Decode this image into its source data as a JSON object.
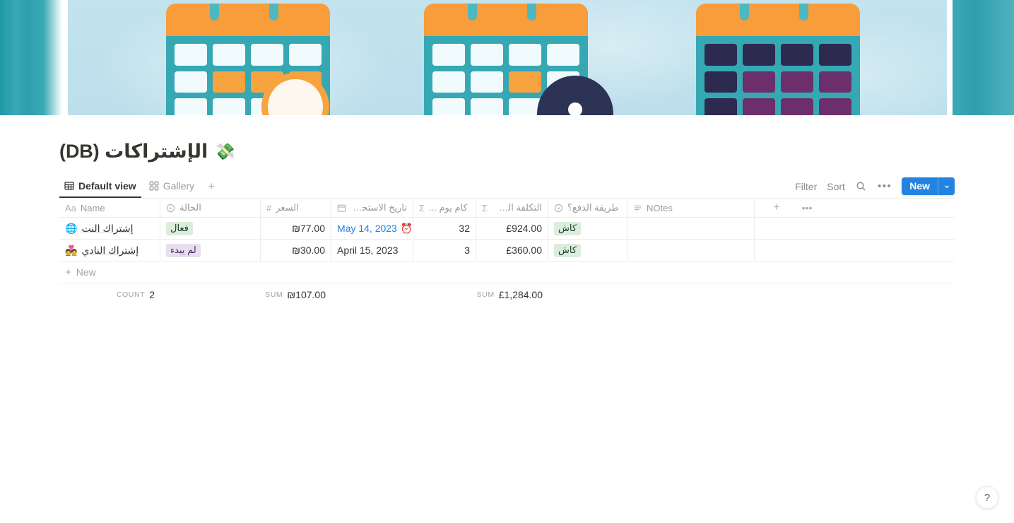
{
  "cover": {
    "alt": "calendar-illustration-banner",
    "colors": {
      "teal": "#35a8b4",
      "orange": "#f99c3a",
      "light_blue": "#bfe0ec",
      "navy": "#2d3355"
    }
  },
  "header": {
    "title": "الإشتراكات (DB)",
    "emoji": "💸"
  },
  "view_tabs": [
    {
      "label": "Default view",
      "icon": "table-icon",
      "active": true
    },
    {
      "label": "Gallery",
      "icon": "gallery-grid-icon",
      "active": false
    }
  ],
  "view_tab_add": "+",
  "toolbar": {
    "filter_label": "Filter",
    "sort_label": "Sort",
    "search_icon": "search-icon",
    "more_icon": "ellipsis-icon",
    "new_label": "New",
    "new_dropdown_icon": "chevron-down-icon",
    "accent_color": "#2383e2"
  },
  "table": {
    "columns": [
      {
        "key": "name",
        "label": "Name",
        "icon": "title-aa-icon",
        "type": "title"
      },
      {
        "key": "status",
        "label": "الحالة",
        "icon": "select-icon",
        "type": "select"
      },
      {
        "key": "price",
        "label": "السعر",
        "icon": "number-hash-icon",
        "type": "number"
      },
      {
        "key": "date",
        "label": "تاريخ الاستحقاق",
        "icon": "calendar-icon",
        "type": "date"
      },
      {
        "key": "days",
        "label": "كام يوم ...",
        "icon": "formula-sigma-icon",
        "type": "formula"
      },
      {
        "key": "annual",
        "label": "التكلفة السنوية",
        "icon": "formula-sigma-icon",
        "type": "formula"
      },
      {
        "key": "pay",
        "label": "طريقة الدفع؟",
        "icon": "select-icon",
        "type": "select"
      },
      {
        "key": "notes",
        "label": "NOtes",
        "icon": "text-lines-icon",
        "type": "text"
      }
    ],
    "add_column_icon": "+",
    "column_options_icon": "ellipsis-icon",
    "rows": [
      {
        "emoji": "🌐",
        "name": "إشتراك النت",
        "status": "فعال",
        "status_color": "green",
        "price": "₪77.00",
        "date": "May 14, 2023",
        "date_reminder_icon": "⏰",
        "date_is_link": true,
        "days": "32",
        "annual": "£924.00",
        "pay": "كاش",
        "pay_color": "green",
        "notes": ""
      },
      {
        "emoji": "💑",
        "name": "إشتراك النادي",
        "status": "لم يبدء",
        "status_color": "purple",
        "price": "₪30.00",
        "date": "April 15, 2023",
        "date_reminder_icon": "",
        "date_is_link": false,
        "days": "3",
        "annual": "£360.00",
        "pay": "كاش",
        "pay_color": "green",
        "notes": ""
      }
    ],
    "new_row_label": "New",
    "new_row_icon": "+",
    "footer": {
      "count_label": "COUNT",
      "count_value": "2",
      "price_sum_label": "SUM",
      "price_sum_value": "₪107.00",
      "annual_sum_label": "SUM",
      "annual_sum_value": "£1,284.00"
    }
  },
  "help": {
    "label": "?"
  }
}
